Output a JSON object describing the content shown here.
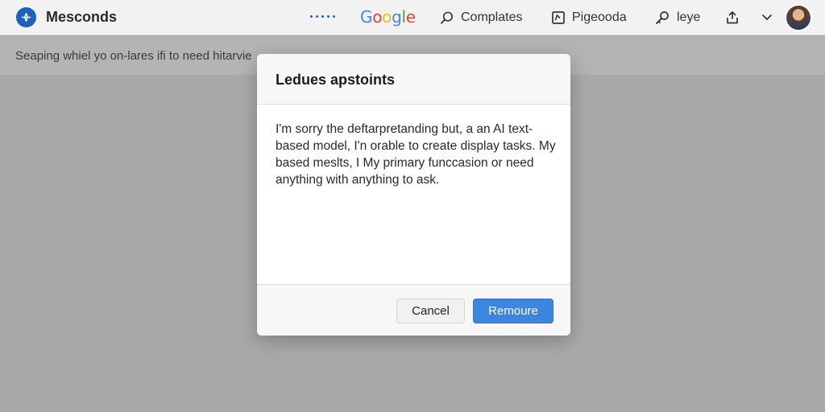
{
  "header": {
    "app_name": "Mesconds",
    "logo_icon": "compass-icon",
    "google_letters": [
      {
        "ch": "G",
        "color": "#4285F4"
      },
      {
        "ch": "o",
        "color": "#EA4335"
      },
      {
        "ch": "o",
        "color": "#FBBC05"
      },
      {
        "ch": "g",
        "color": "#4285F4"
      },
      {
        "ch": "l",
        "color": "#34A853"
      },
      {
        "ch": "e",
        "color": "#EA4335"
      }
    ],
    "nav": {
      "complates": "Complates",
      "pigeooda": "Pigeooda",
      "leye": "leye"
    }
  },
  "subbar": {
    "text": "Seaping whiel yo on-lares ifi to need hitarvie"
  },
  "dialog": {
    "title": "Ledues apstoints",
    "body": "I'm sorry the deftarpretanding but, a an AI text-based model, I'n orable to create display tasks. My based meslts, I My primary funccasion or need anything with anything to ask.",
    "cancel_label": "Cancel",
    "primary_label": "Remoure"
  },
  "colors": {
    "accent": "#3d86e0",
    "logo": "#1f5fbf"
  }
}
